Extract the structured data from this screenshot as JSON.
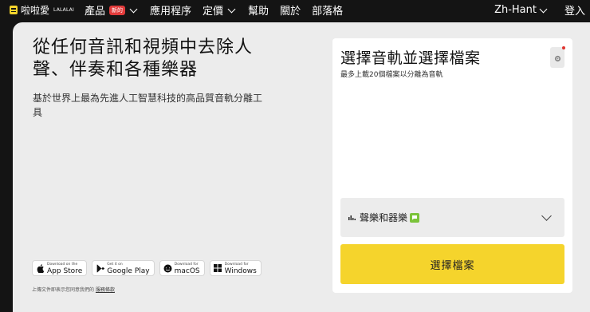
{
  "brand": {
    "name": "啦啦愛",
    "sup": "LALALAI"
  },
  "nav": {
    "products": "產品",
    "badge_new": "新的",
    "apps": "應用程序",
    "pricing": "定價",
    "help": "幫助",
    "about": "關於",
    "blog": "部落格",
    "language": "Zh-Hant",
    "login": "登入"
  },
  "hero": {
    "headline": "從任何音訊和視頻中去除人聲、伴奏和各種樂器",
    "subline": "基於世界上最為先進人工智慧科技的高品質音軌分離工具"
  },
  "stores": [
    {
      "small": "Download on the",
      "big": "App Store",
      "icon": "apple-icon"
    },
    {
      "small": "Get it on",
      "big": "Google Play",
      "icon": "google-play-icon"
    },
    {
      "small": "Download for",
      "big": "macOS",
      "icon": "finder-icon"
    },
    {
      "small": "Download for",
      "big": "Windows",
      "icon": "windows-icon"
    }
  ],
  "disclaimer": {
    "text": "上傳文件即表示您同意我們的",
    "link": "服務條款"
  },
  "panel": {
    "title": "選擇音軌並選擇檔案",
    "subtitle": "最多上載20個檔案以分離為音軌",
    "select_value": "聲樂和器樂",
    "choose_button": "選擇檔案"
  },
  "colors": {
    "accent": "#f5d42c",
    "background": "#141414",
    "card": "#ececec",
    "badge": "#e23b3b",
    "chat_badge": "#7bc33a"
  }
}
